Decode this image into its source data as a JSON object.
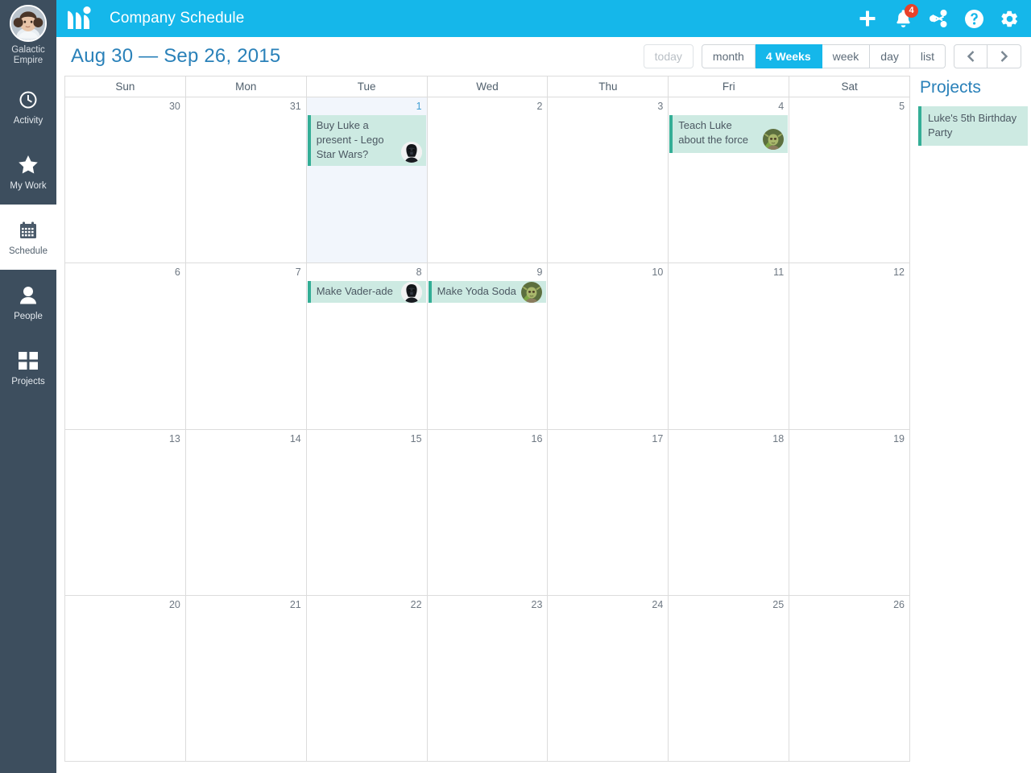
{
  "rail": {
    "account": {
      "avatar": "leia-avatar",
      "name": "Galactic\nEmpire",
      "name_line1": "Galactic",
      "name_line2": "Empire"
    },
    "items": [
      {
        "label": "Activity",
        "icon": "clock-icon",
        "active": false
      },
      {
        "label": "My Work",
        "icon": "star-icon",
        "active": false
      },
      {
        "label": "Schedule",
        "icon": "calendar-icon",
        "active": true
      },
      {
        "label": "People",
        "icon": "person-icon",
        "active": false
      },
      {
        "label": "Projects",
        "icon": "grid-icon",
        "active": false
      }
    ]
  },
  "topbar": {
    "logo": "mavenlink-logo",
    "title": "Company Schedule",
    "accent_color": "#15b7ea",
    "actions": [
      {
        "name": "add-button",
        "icon": "plus-icon",
        "badge": null
      },
      {
        "name": "notifications-button",
        "icon": "bell-icon",
        "badge": "4"
      },
      {
        "name": "share-button",
        "icon": "share-icon",
        "badge": null
      },
      {
        "name": "help-button",
        "icon": "question-icon",
        "badge": null
      },
      {
        "name": "settings-button",
        "icon": "gear-icon",
        "badge": null
      }
    ]
  },
  "subheader": {
    "range_title": "Aug 30 — Sep 26, 2015",
    "today_label": "today",
    "views": [
      {
        "label": "month",
        "active": false
      },
      {
        "label": "4 Weeks",
        "active": true
      },
      {
        "label": "week",
        "active": false
      },
      {
        "label": "day",
        "active": false
      },
      {
        "label": "list",
        "active": false
      }
    ],
    "prev_label": "‹",
    "next_label": "›"
  },
  "calendar": {
    "day_headers": [
      "Sun",
      "Mon",
      "Tue",
      "Wed",
      "Thu",
      "Fri",
      "Sat"
    ],
    "weeks": [
      [
        {
          "day": "30",
          "today": false,
          "events": []
        },
        {
          "day": "31",
          "today": false,
          "events": []
        },
        {
          "day": "1",
          "today": true,
          "events": [
            {
              "title": "Buy Luke a present - Lego Star Wars?",
              "avatar": "vader-avatar",
              "lines": 2
            }
          ]
        },
        {
          "day": "2",
          "today": false,
          "events": []
        },
        {
          "day": "3",
          "today": false,
          "events": []
        },
        {
          "day": "4",
          "today": false,
          "events": [
            {
              "title": "Teach Luke about the force",
              "avatar": "yoda-avatar",
              "lines": 2
            }
          ]
        },
        {
          "day": "5",
          "today": false,
          "events": []
        }
      ],
      [
        {
          "day": "6",
          "today": false,
          "events": []
        },
        {
          "day": "7",
          "today": false,
          "events": []
        },
        {
          "day": "8",
          "today": false,
          "events": [
            {
              "title": "Make Vader-ade",
              "avatar": "vader-avatar",
              "lines": 1
            }
          ]
        },
        {
          "day": "9",
          "today": false,
          "events": [
            {
              "title": "Make Yoda Soda",
              "avatar": "yoda-avatar",
              "lines": 1
            }
          ]
        },
        {
          "day": "10",
          "today": false,
          "events": []
        },
        {
          "day": "11",
          "today": false,
          "events": []
        },
        {
          "day": "12",
          "today": false,
          "events": []
        }
      ],
      [
        {
          "day": "13",
          "today": false,
          "events": []
        },
        {
          "day": "14",
          "today": false,
          "events": []
        },
        {
          "day": "15",
          "today": false,
          "events": []
        },
        {
          "day": "16",
          "today": false,
          "events": []
        },
        {
          "day": "17",
          "today": false,
          "events": []
        },
        {
          "day": "18",
          "today": false,
          "events": []
        },
        {
          "day": "19",
          "today": false,
          "events": []
        }
      ],
      [
        {
          "day": "20",
          "today": false,
          "events": []
        },
        {
          "day": "21",
          "today": false,
          "events": []
        },
        {
          "day": "22",
          "today": false,
          "events": []
        },
        {
          "day": "23",
          "today": false,
          "events": []
        },
        {
          "day": "24",
          "today": false,
          "events": []
        },
        {
          "day": "25",
          "today": false,
          "events": []
        },
        {
          "day": "26",
          "today": false,
          "events": []
        }
      ]
    ],
    "event_color": "#cdeae2",
    "event_accent": "#34ae96",
    "today_color": "#f2f6fc"
  },
  "projects": {
    "title": "Projects",
    "items": [
      {
        "label": "Luke's 5th Birthday Party"
      }
    ]
  }
}
